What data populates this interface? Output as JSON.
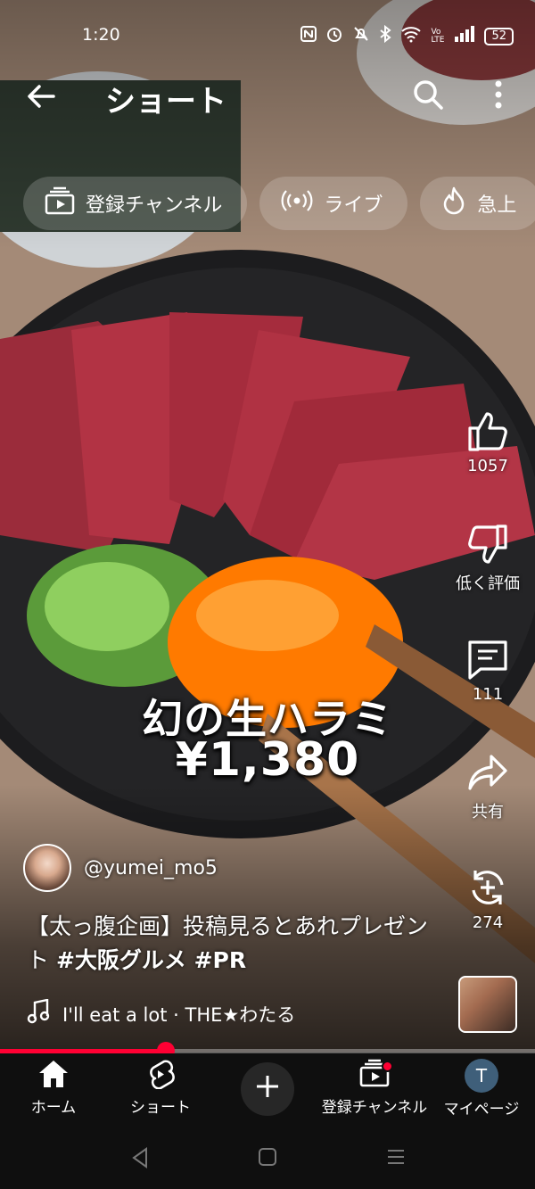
{
  "status_bar": {
    "time": "1:20",
    "battery": "52",
    "icons": [
      "nfc-icon",
      "alarm-icon",
      "mute-icon",
      "bluetooth-icon",
      "wifi-icon",
      "volte-icon",
      "signal-icon",
      "battery-icon"
    ],
    "volte_label": "Vo LTE"
  },
  "app_bar": {
    "title": "ショート",
    "back_icon": "arrow-left-icon",
    "search_icon": "search-icon",
    "more_icon": "more-vert-icon"
  },
  "chips": [
    {
      "label": "登録チャンネル",
      "icon": "subscriptions-icon"
    },
    {
      "label": "ライブ",
      "icon": "live-icon"
    },
    {
      "label": "急上",
      "icon": "trending-icon"
    }
  ],
  "video": {
    "overlay_title": "幻の生ハラミ",
    "overlay_price": "¥1,380"
  },
  "actions": {
    "like": {
      "label": "1057",
      "icon": "thumb-up-icon"
    },
    "dislike": {
      "label": "低く評価",
      "icon": "thumb-down-icon"
    },
    "comment": {
      "label": "111",
      "icon": "comment-icon"
    },
    "share": {
      "label": "共有",
      "icon": "share-icon"
    },
    "remix": {
      "label": "274",
      "icon": "remix-icon"
    }
  },
  "channel": {
    "handle": "@yumei_mo5"
  },
  "caption": {
    "text": "【太っ腹企画】投稿見るとあれプレゼント ",
    "tags": "#大阪グルメ #PR"
  },
  "music": {
    "title": "I'll eat a lot · THE★わたる",
    "icon": "music-note-icon"
  },
  "progress": {
    "fraction": 0.31
  },
  "bottom_nav": [
    {
      "label": "ホーム",
      "icon": "home-icon"
    },
    {
      "label": "ショート",
      "icon": "shorts-icon"
    },
    {
      "label": "",
      "icon": "plus-icon"
    },
    {
      "label": "登録チャンネル",
      "icon": "subscriptions-icon"
    },
    {
      "label": "マイページ",
      "icon": "avatar-icon",
      "avatar_letter": "T"
    }
  ],
  "colors": {
    "accent": "#ff0033",
    "nav_bg": "#0f0f0f",
    "chip_bg": "rgba(255,255,255,0.18)"
  }
}
